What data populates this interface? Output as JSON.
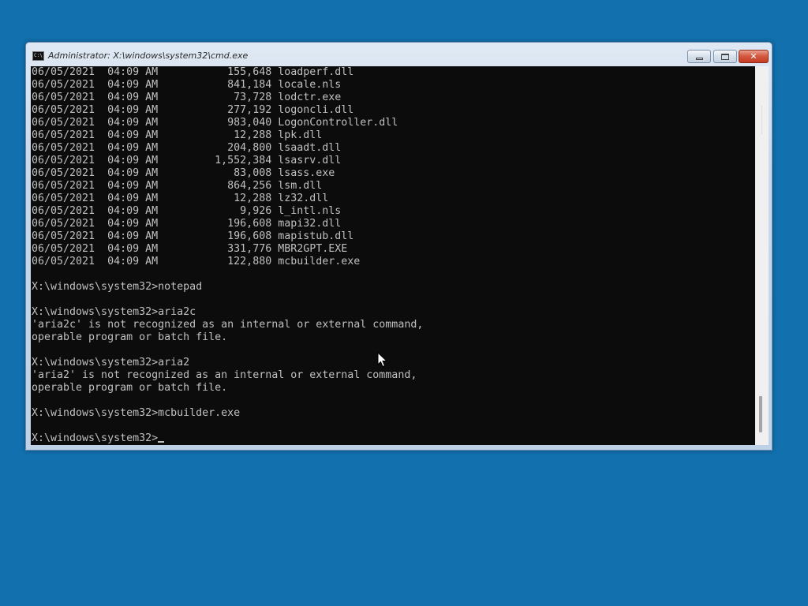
{
  "window": {
    "title": "Administrator: X:\\windows\\system32\\cmd.exe",
    "icon": "cmd-icon",
    "controls": {
      "minimize": "minimize-icon",
      "maximize": "maximize-icon",
      "close_label": "✕"
    }
  },
  "console": {
    "lines": [
      "06/05/2021  04:09 AM           155,648 loadperf.dll",
      "06/05/2021  04:09 AM           841,184 locale.nls",
      "06/05/2021  04:09 AM            73,728 lodctr.exe",
      "06/05/2021  04:09 AM           277,192 logoncli.dll",
      "06/05/2021  04:09 AM           983,040 LogonController.dll",
      "06/05/2021  04:09 AM            12,288 lpk.dll",
      "06/05/2021  04:09 AM           204,800 lsaadt.dll",
      "06/05/2021  04:09 AM         1,552,384 lsasrv.dll",
      "06/05/2021  04:09 AM            83,008 lsass.exe",
      "06/05/2021  04:09 AM           864,256 lsm.dll",
      "06/05/2021  04:09 AM            12,288 lz32.dll",
      "06/05/2021  04:09 AM             9,926 l_intl.nls",
      "06/05/2021  04:09 AM           196,608 mapi32.dll",
      "06/05/2021  04:09 AM           196,608 mapistub.dll",
      "06/05/2021  04:09 AM           331,776 MBR2GPT.EXE",
      "06/05/2021  04:09 AM           122,880 mcbuilder.exe",
      "",
      "X:\\windows\\system32>notepad",
      "",
      "X:\\windows\\system32>aria2c",
      "'aria2c' is not recognized as an internal or external command,",
      "operable program or batch file.",
      "",
      "X:\\windows\\system32>aria2",
      "'aria2' is not recognized as an internal or external command,",
      "operable program or batch file.",
      "",
      "X:\\windows\\system32>mcbuilder.exe",
      ""
    ],
    "prompt": "X:\\windows\\system32>"
  },
  "colors": {
    "desktop": "#1170ad",
    "console_bg": "#0c0c0c",
    "console_text": "#c0c0c0"
  }
}
